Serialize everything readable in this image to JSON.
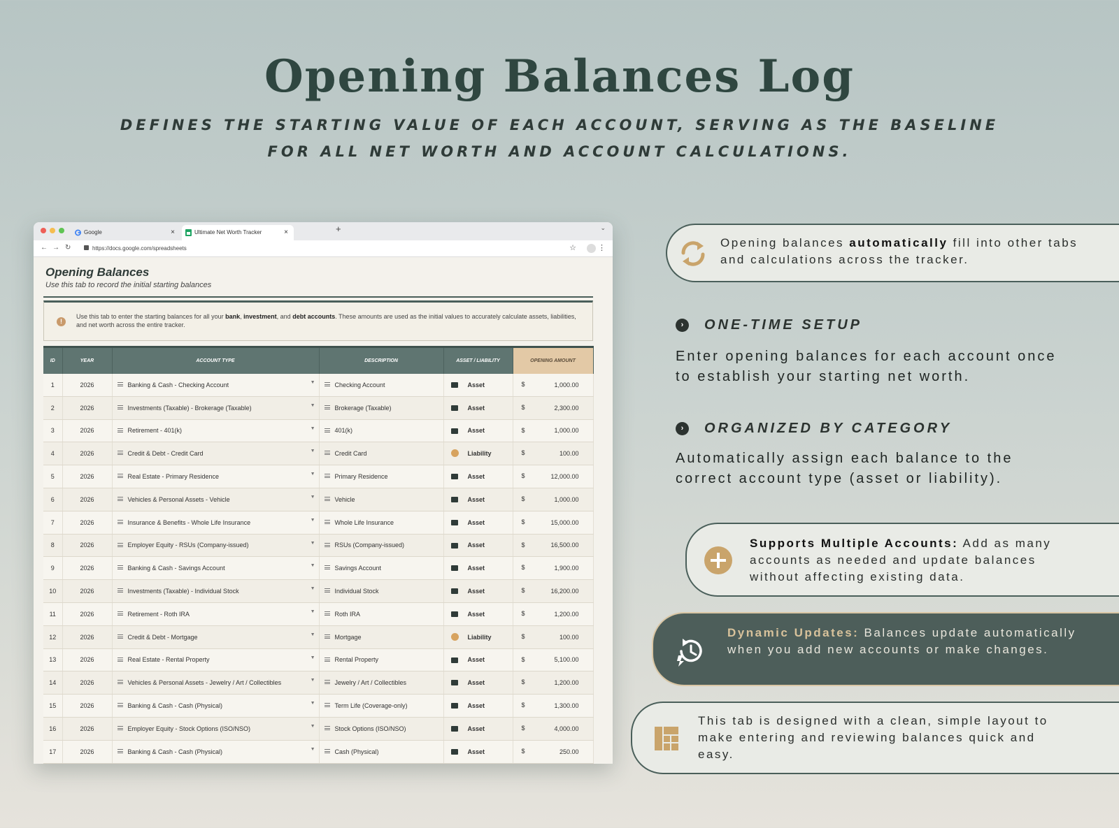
{
  "hero": {
    "title": "Opening Balances Log",
    "subtitle": "Defines the starting value of each account, serving as the baseline for all net worth and account calculations."
  },
  "browser": {
    "tabs": [
      {
        "label": "Google"
      },
      {
        "label": "Ultimate Net Worth Tracker"
      }
    ],
    "url": "https://docs.google.com/spreadsheets"
  },
  "sheet": {
    "title": "Opening Balances",
    "subtitle": "Use this tab to record the initial starting balances",
    "notice": {
      "part1": "Use this tab to enter the starting balances for all your ",
      "bold1": "bank",
      "sep1": ", ",
      "bold2": "investment",
      "sep2": ", and ",
      "bold3": "debt accounts",
      "part2": ". These amounts are used as the initial values to accurately calculate assets, liabilities, and net worth across the entire tracker."
    },
    "columns": [
      "ID",
      "Year",
      "Account Type",
      "Description",
      "Asset / Liability",
      "Opening Amount"
    ],
    "currency": "$",
    "rows": [
      {
        "id": "1",
        "year": "2026",
        "type": "Banking & Cash - Checking Account",
        "desc": "Checking Account",
        "al": "Asset",
        "amount": "1,000.00"
      },
      {
        "id": "2",
        "year": "2026",
        "type": "Investments (Taxable) - Brokerage (Taxable)",
        "desc": "Brokerage (Taxable)",
        "al": "Asset",
        "amount": "2,300.00"
      },
      {
        "id": "3",
        "year": "2026",
        "type": "Retirement - 401(k)",
        "desc": "401(k)",
        "al": "Asset",
        "amount": "1,000.00"
      },
      {
        "id": "4",
        "year": "2026",
        "type": "Credit & Debt - Credit Card",
        "desc": "Credit Card",
        "al": "Liability",
        "amount": "100.00"
      },
      {
        "id": "5",
        "year": "2026",
        "type": "Real Estate - Primary Residence",
        "desc": "Primary Residence",
        "al": "Asset",
        "amount": "12,000.00"
      },
      {
        "id": "6",
        "year": "2026",
        "type": "Vehicles & Personal Assets - Vehicle",
        "desc": "Vehicle",
        "al": "Asset",
        "amount": "1,000.00"
      },
      {
        "id": "7",
        "year": "2026",
        "type": "Insurance & Benefits - Whole Life Insurance",
        "desc": "Whole Life Insurance",
        "al": "Asset",
        "amount": "15,000.00"
      },
      {
        "id": "8",
        "year": "2026",
        "type": "Employer Equity - RSUs (Company-issued)",
        "desc": "RSUs (Company-issued)",
        "al": "Asset",
        "amount": "16,500.00"
      },
      {
        "id": "9",
        "year": "2026",
        "type": "Banking & Cash - Savings Account",
        "desc": "Savings Account",
        "al": "Asset",
        "amount": "1,900.00"
      },
      {
        "id": "10",
        "year": "2026",
        "type": "Investments (Taxable) - Individual Stock",
        "desc": "Individual Stock",
        "al": "Asset",
        "amount": "16,200.00"
      },
      {
        "id": "11",
        "year": "2026",
        "type": "Retirement - Roth IRA",
        "desc": "Roth IRA",
        "al": "Asset",
        "amount": "1,200.00"
      },
      {
        "id": "12",
        "year": "2026",
        "type": "Credit & Debt - Mortgage",
        "desc": "Mortgage",
        "al": "Liability",
        "amount": "100.00"
      },
      {
        "id": "13",
        "year": "2026",
        "type": "Real Estate - Rental Property",
        "desc": "Rental Property",
        "al": "Asset",
        "amount": "5,100.00"
      },
      {
        "id": "14",
        "year": "2026",
        "type": "Vehicles & Personal Assets - Jewelry / Art / Collectibles",
        "desc": "Jewelry / Art / Collectibles",
        "al": "Asset",
        "amount": "1,200.00"
      },
      {
        "id": "15",
        "year": "2026",
        "type": "Banking & Cash - Cash (Physical)",
        "desc": "Term Life (Coverage-only)",
        "al": "Asset",
        "amount": "1,300.00"
      },
      {
        "id": "16",
        "year": "2026",
        "type": "Employer Equity - Stock Options (ISO/NSO)",
        "desc": "Stock Options (ISO/NSO)",
        "al": "Asset",
        "amount": "4,000.00"
      },
      {
        "id": "17",
        "year": "2026",
        "type": "Banking & Cash - Cash (Physical)",
        "desc": "Cash (Physical)",
        "al": "Asset",
        "amount": "250.00"
      }
    ]
  },
  "features": {
    "auto_fill": {
      "pre": "Opening balances ",
      "bold": "automatically",
      "post": " fill into other tabs and calculations across the tracker."
    },
    "setup": {
      "heading": "One-Time Setup",
      "body": "Enter opening balances for each account once to establish your starting net worth."
    },
    "category": {
      "heading": "Organized by Category",
      "body": "Automatically assign each balance to the correct account type (asset or liability)."
    },
    "multi": {
      "bold": "Supports Multiple Accounts:",
      "post": " Add as many accounts as needed and update balances without affecting existing data."
    },
    "dynamic": {
      "bold": "Dynamic Updates:",
      "post": " Balances update automatically when you add new accounts or make changes."
    },
    "layout": {
      "text": "This tab is designed with a clean, simple layout to make entering and reviewing balances quick and easy."
    }
  },
  "colors": {
    "accent_dark": "#4d5e5a",
    "accent_gold": "#c9a46b",
    "header_teal": "#5f7571",
    "amount_header": "#e3c9a6"
  }
}
